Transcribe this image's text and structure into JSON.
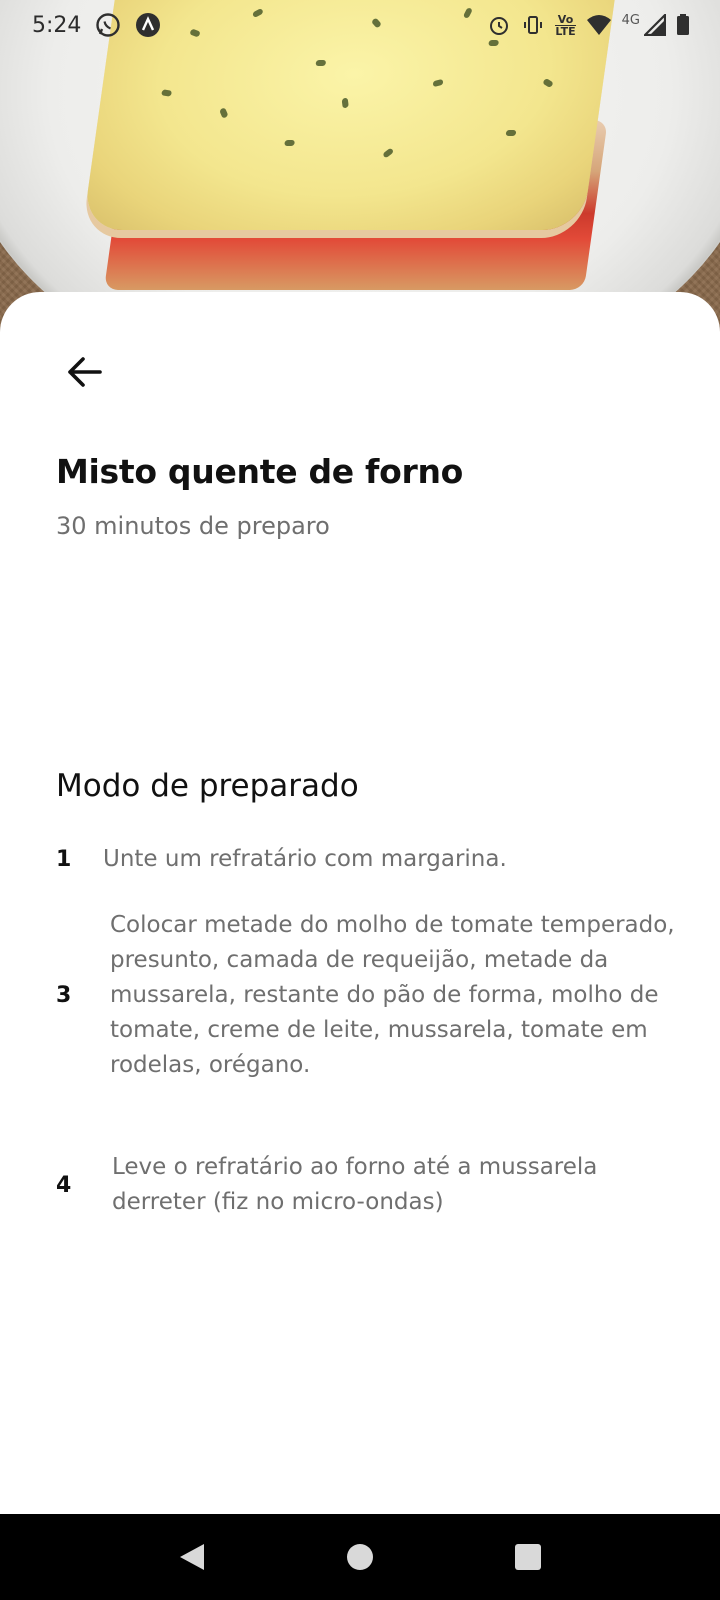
{
  "status_bar": {
    "time": "5:24",
    "network_volte": "Vo",
    "network_lte": "LTE",
    "network_4g": "4G",
    "icons": [
      "whatsapp-icon",
      "app-notification-icon",
      "alarm-icon",
      "vibrate-icon",
      "volte-icon",
      "wifi-icon",
      "signal-icon",
      "battery-icon"
    ]
  },
  "hero": {
    "image": "lasagna-photo"
  },
  "recipe": {
    "title": "Misto quente de forno",
    "prep_time": "30 minutos de preparo",
    "section_title": "Modo de preparado",
    "steps": [
      {
        "number": "1",
        "text": "Unte um refratário com margarina."
      },
      {
        "number": "3",
        "text": "Colocar metade do molho de tomate temperado, presunto, camada de requeijão, metade da mussarela, restante do pão de forma, molho de tomate, creme de leite, mussarela, tomate em rodelas, orégano."
      },
      {
        "number": "4",
        "text": "Leve o refratário ao forno até a mussarela derreter (fiz no micro-ondas)"
      }
    ]
  },
  "nav_bar": {
    "icons": [
      "back-icon",
      "home-icon",
      "recents-icon"
    ]
  }
}
